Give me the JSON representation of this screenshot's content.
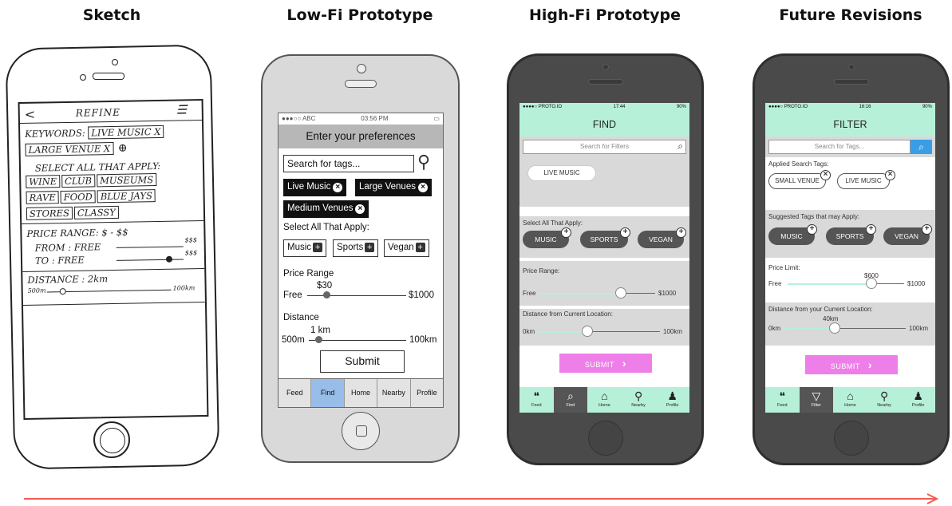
{
  "columns": [
    "Sketch",
    "Low-Fi Prototype",
    "High-Fi Prototype",
    "Future Revisions"
  ],
  "sketch": {
    "title": "REFINE",
    "keywords_label": "KEYWORDS:",
    "keywords": [
      "LIVE MUSIC X",
      "LARGE VENUE X"
    ],
    "select_label": "SELECT ALL THAT APPLY:",
    "tags_row1": [
      "WINE",
      "CLUB",
      "MUSEUMS"
    ],
    "tags_row2": [
      "RAVE",
      "FOOD",
      "BLUE JAYS"
    ],
    "tags_row3": [
      "STORES",
      "CLASSY"
    ],
    "price_label": "PRICE RANGE: $ - $$",
    "from_label": "FROM : FREE",
    "to_label": "TO :   FREE",
    "from_max": "$$$",
    "to_max": "$$$",
    "distance_label": "DISTANCE : 2km",
    "distance_min": "500m",
    "distance_max": "100km"
  },
  "lofi": {
    "status": {
      "carrier": "●●●○○ ABC",
      "time": "03:56 PM"
    },
    "header": "Enter your preferences",
    "search_placeholder": "Search for tags...",
    "chips": [
      "Live Music",
      "Large Venues",
      "Medium Venues"
    ],
    "select_label": "Select All That Apply:",
    "categories": [
      "Music",
      "Sports",
      "Vegan"
    ],
    "price_label": "Price Range",
    "price_value": "$30",
    "price_min": "Free",
    "price_max": "$1000",
    "distance_label": "Distance",
    "distance_value": "1 km",
    "distance_min": "500m",
    "distance_max": "100km",
    "submit": "Submit",
    "tabs": [
      "Feed",
      "Find",
      "Home",
      "Nearby",
      "Profile"
    ],
    "active_tab": "Find"
  },
  "hifi": {
    "status": {
      "carrier": "●●●●○ PROTO.IO",
      "time": "17:44",
      "battery": "90%"
    },
    "header": "FIND",
    "search_placeholder": "Search for Filters",
    "applied_tag": "LIVE MUSIC",
    "select_label": "Select All That Apply:",
    "categories": [
      "MUSIC",
      "SPORTS",
      "VEGAN"
    ],
    "price_label": "Price Range:",
    "price_min": "Free",
    "price_max": "$1000",
    "distance_label": "Distance from Current Location:",
    "distance_min": "0km",
    "distance_max": "100km",
    "submit": "SUBMIT",
    "tabs": [
      {
        "label": "Feed",
        "icon": "quote-icon"
      },
      {
        "label": "Find",
        "icon": "search-icon"
      },
      {
        "label": "Home",
        "icon": "home-icon"
      },
      {
        "label": "Nearby",
        "icon": "pin-icon"
      },
      {
        "label": "Profile",
        "icon": "user-icon"
      }
    ],
    "active_tab": "Find"
  },
  "future": {
    "status": {
      "carrier": "●●●●○ PROTO.IO",
      "time": "16:16",
      "battery": "90%"
    },
    "header": "FILTER",
    "search_placeholder": "Search for Tags...",
    "applied_label": "Applied Search Tags:",
    "applied_tags": [
      "SMALL VENUE",
      "LIVE MUSIC"
    ],
    "suggested_label": "Suggested Tags that may Apply:",
    "categories": [
      "MUSIC",
      "SPORTS",
      "VEGAN"
    ],
    "price_label": "Price Limit:",
    "price_value": "$600",
    "price_min": "Free",
    "price_max": "$1000",
    "distance_label": "Distance from your Current Location:",
    "distance_value": "40km",
    "distance_min": "0km",
    "distance_max": "100km",
    "submit": "SUBMIT",
    "tabs": [
      {
        "label": "Feed",
        "icon": "quote-icon"
      },
      {
        "label": "Filter",
        "icon": "filter-icon"
      },
      {
        "label": "Home",
        "icon": "home-icon"
      },
      {
        "label": "Nearby",
        "icon": "pin-icon"
      },
      {
        "label": "Profile",
        "icon": "user-icon"
      }
    ],
    "active_tab": "Filter"
  },
  "colors": {
    "mint": "#b7f0d8",
    "submit_pink": "#ef7fe8",
    "search_blue": "#3a9ee6",
    "lofi_active_tab": "#98bde8",
    "arrow": "#f25c54"
  }
}
